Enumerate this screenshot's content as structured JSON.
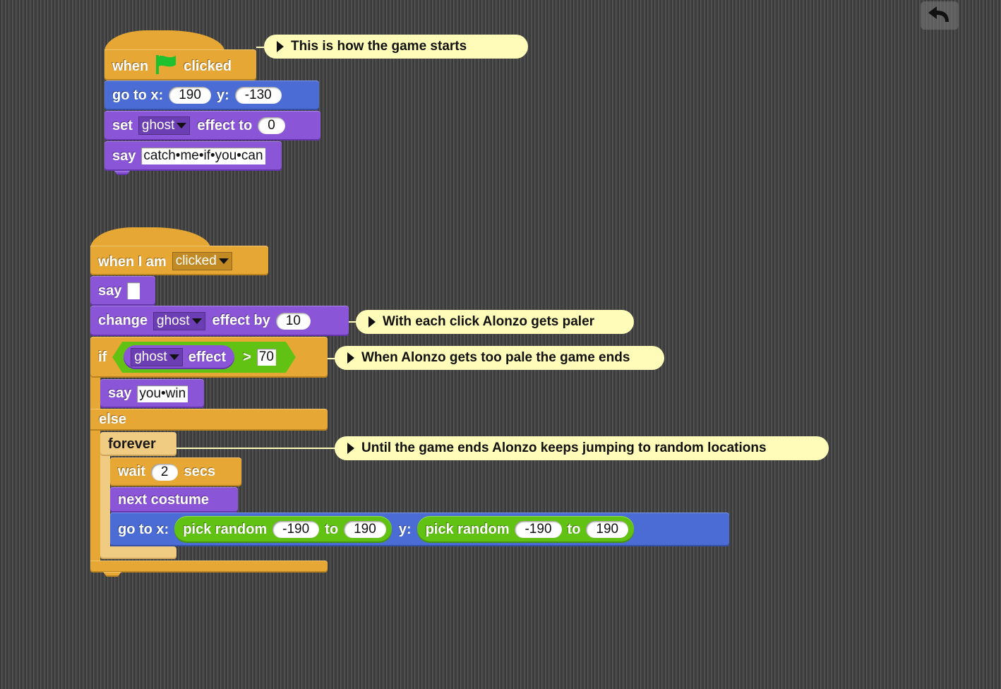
{
  "toolbar": {
    "undo_icon": "undo-arrow-icon"
  },
  "colors": {
    "control": "#e6a735",
    "motion": "#4a6cd4",
    "looks": "#8a55d7",
    "operators": "#62c213",
    "comment": "#fefcb8",
    "flag": "#1fc12f"
  },
  "script1": {
    "hat": {
      "when": "when",
      "icon": "green-flag-icon",
      "clicked": "clicked"
    },
    "goto": {
      "label": "go to x:",
      "x": "190",
      "ylabel": "y:",
      "y": "-130"
    },
    "set_effect": {
      "set": "set",
      "effect": "ghost",
      "effect_to": "effect to",
      "value": "0"
    },
    "say": {
      "label": "say",
      "text": "catch•me•if•you•can"
    },
    "comment": "This is how the game starts"
  },
  "script2": {
    "hat": {
      "label": "when I am",
      "event": "clicked"
    },
    "say_empty": {
      "label": "say",
      "text": ""
    },
    "change_effect": {
      "change": "change",
      "effect": "ghost",
      "by": "effect by",
      "value": "10"
    },
    "if_block": {
      "if": "if",
      "effect": "ghost",
      "effect_label": "effect",
      "op": ">",
      "threshold": "70"
    },
    "say_win": {
      "label": "say",
      "text": "you•win"
    },
    "else": "else",
    "forever": "forever",
    "wait": {
      "label": "wait",
      "value": "2",
      "unit": "secs"
    },
    "next_costume": "next costume",
    "goto_random": {
      "label": "go to x:",
      "pick1": "pick random",
      "x_from": "-190",
      "to1": "to",
      "x_to": "190",
      "ylabel": "y:",
      "pick2": "pick random",
      "y_from": "-190",
      "to2": "to",
      "y_to": "190"
    },
    "comments": {
      "change": "With each click Alonzo gets paler",
      "if": "When Alonzo gets too pale the game ends",
      "forever": "Until the game ends Alonzo keeps jumping to random locations"
    }
  }
}
